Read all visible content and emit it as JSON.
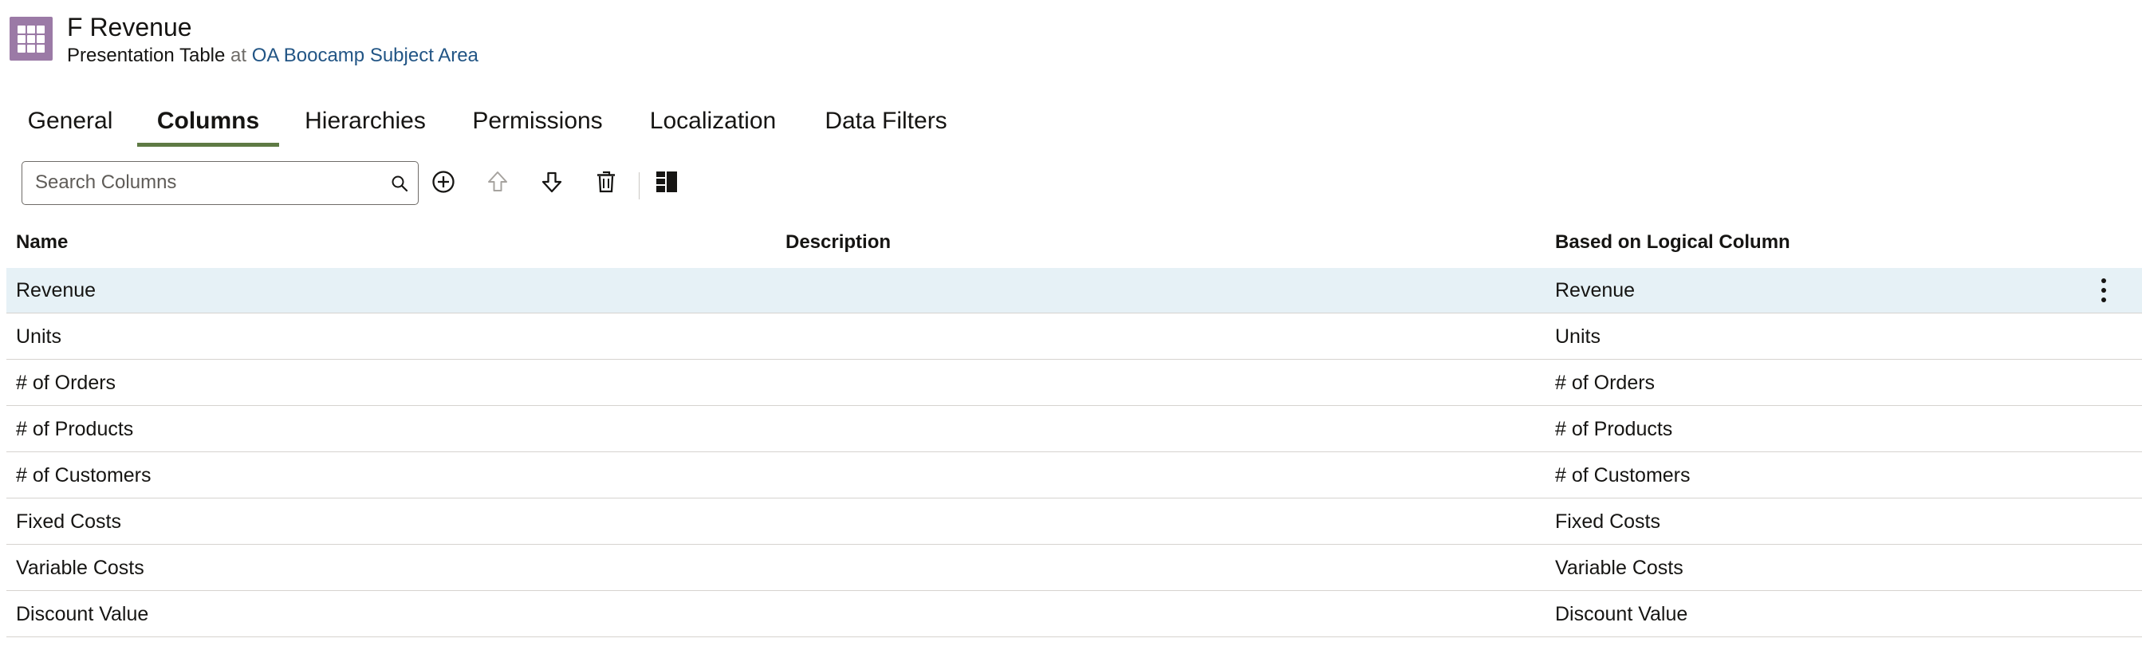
{
  "header": {
    "title": "F Revenue",
    "object_type": "Presentation Table",
    "at_word": "at",
    "subject_area": "OA Boocamp Subject Area",
    "icon": "table-grid-icon",
    "icon_color": "#9b7aa6"
  },
  "tabs": [
    {
      "label": "General",
      "active": false
    },
    {
      "label": "Columns",
      "active": true
    },
    {
      "label": "Hierarchies",
      "active": false
    },
    {
      "label": "Permissions",
      "active": false
    },
    {
      "label": "Localization",
      "active": false
    },
    {
      "label": "Data Filters",
      "active": false
    }
  ],
  "toolbar": {
    "search_placeholder": "Search Columns",
    "search_value": "",
    "add_icon": "add-circle-icon",
    "move_up_icon": "arrow-up-icon",
    "move_down_icon": "arrow-down-icon",
    "delete_icon": "trash-icon",
    "layout_icon": "panel-layout-icon"
  },
  "table": {
    "headers": [
      "Name",
      "Description",
      "Based on Logical Column"
    ],
    "rows": [
      {
        "name": "Revenue",
        "description": "",
        "logical": "Revenue",
        "selected": true
      },
      {
        "name": "Units",
        "description": "",
        "logical": "Units",
        "selected": false
      },
      {
        "name": "# of Orders",
        "description": "",
        "logical": "# of Orders",
        "selected": false
      },
      {
        "name": "# of Products",
        "description": "",
        "logical": "# of Products",
        "selected": false
      },
      {
        "name": "# of Customers",
        "description": "",
        "logical": "# of Customers",
        "selected": false
      },
      {
        "name": "Fixed Costs",
        "description": "",
        "logical": "Fixed Costs",
        "selected": false
      },
      {
        "name": "Variable Costs",
        "description": "",
        "logical": "Variable Costs",
        "selected": false
      },
      {
        "name": "Discount Value",
        "description": "",
        "logical": "Discount Value",
        "selected": false
      }
    ]
  },
  "colors": {
    "accent_tab": "#5e7a44",
    "link": "#225585",
    "selected_row": "#e6f1f6"
  }
}
